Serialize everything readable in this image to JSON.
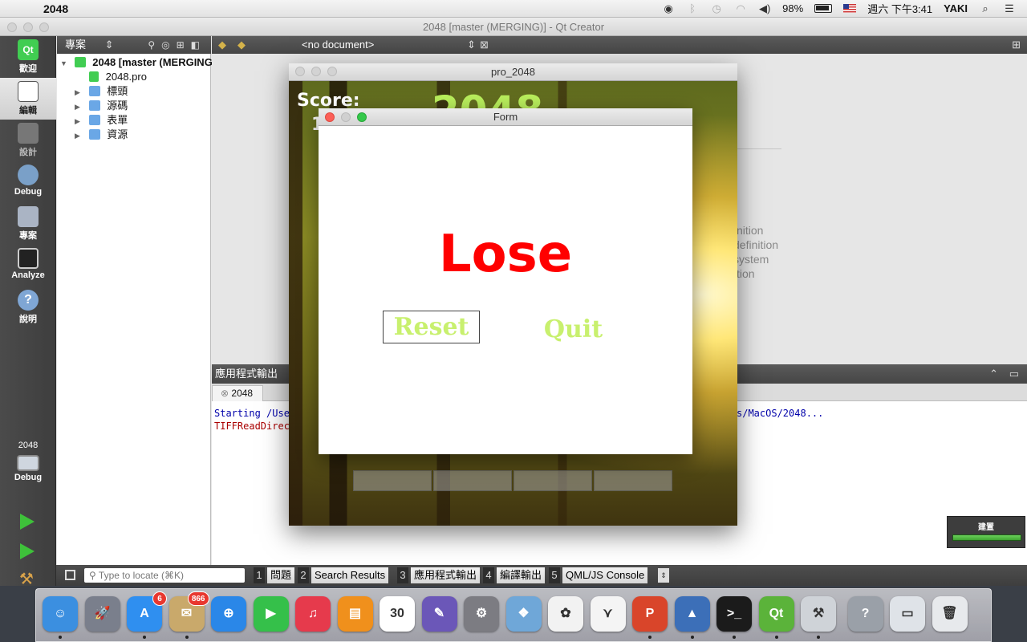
{
  "menubar": {
    "app_name": "2048",
    "battery": "98%",
    "datetime": "週六 下午3:41",
    "user": "YAKI"
  },
  "qt": {
    "window_title": "2048 [master (MERGING)] - Qt Creator",
    "modes": [
      {
        "label": "歡迎",
        "icon": "qt-welcome-icon"
      },
      {
        "label": "編輯",
        "icon": "edit-icon"
      },
      {
        "label": "設計",
        "icon": "design-icon"
      },
      {
        "label": "Debug",
        "icon": "debug-icon"
      },
      {
        "label": "專案",
        "icon": "projects-icon"
      },
      {
        "label": "Analyze",
        "icon": "analyze-icon"
      },
      {
        "label": "說明",
        "icon": "help-icon"
      }
    ],
    "kit": {
      "project": "2048",
      "build": "Debug"
    },
    "projects_pane": {
      "title": "專案",
      "root": "2048 [master (MERGING)]",
      "items": [
        "2048.pro",
        "標頭",
        "源碼",
        "表單",
        "資源"
      ]
    },
    "editor": {
      "document": "<no document>"
    },
    "welcome_fragments": [
      "nition",
      "definition",
      "system",
      "tion"
    ],
    "output": {
      "title": "應用程式輸出",
      "tab": "2048",
      "line1a": "Starting /Use",
      "line1b": "s/MacOS/2048...",
      "line2": "TIFFReadDirec"
    },
    "status": {
      "locate_placeholder": "Type to locate (⌘K)",
      "panes": [
        {
          "num": "1",
          "label": "問題"
        },
        {
          "num": "2",
          "label": "Search Results"
        },
        {
          "num": "3",
          "label": "應用程式輸出"
        },
        {
          "num": "4",
          "label": "編譯輸出"
        },
        {
          "num": "5",
          "label": "QML/JS Console"
        }
      ]
    },
    "build_status": {
      "label": "建置",
      "progress": 1.0
    }
  },
  "game": {
    "window_title": "pro_2048",
    "score_label": "Score:",
    "score_value": "1",
    "title": "2048"
  },
  "dialog": {
    "title": "Form",
    "message": "Lose",
    "reset_label": "Reset",
    "quit_label": "Quit"
  },
  "dock": {
    "apps": [
      {
        "name": "finder",
        "glyph": "☺",
        "color": "#3b8fe0",
        "running": true
      },
      {
        "name": "launchpad",
        "glyph": "🚀",
        "color": "#7a7f8c",
        "running": false
      },
      {
        "name": "app-store",
        "glyph": "A",
        "color": "#2f8ff0",
        "badge": "6",
        "running": true
      },
      {
        "name": "mail",
        "glyph": "✉",
        "color": "#c9a96b",
        "badge": "866",
        "running": true
      },
      {
        "name": "safari",
        "glyph": "⊕",
        "color": "#2a87e8",
        "running": false
      },
      {
        "name": "facetime",
        "glyph": "▶",
        "color": "#35c04a",
        "running": false
      },
      {
        "name": "itunes",
        "glyph": "♫",
        "color": "#e63a4c",
        "running": false
      },
      {
        "name": "ibooks",
        "glyph": "▤",
        "color": "#f0901c",
        "running": false
      },
      {
        "name": "calendar",
        "glyph": "30",
        "color": "#ffffff",
        "running": false
      },
      {
        "name": "script-editor",
        "glyph": "✎",
        "color": "#6b57b8",
        "running": false
      },
      {
        "name": "system-preferences",
        "glyph": "⚙",
        "color": "#7c7c82",
        "running": false
      },
      {
        "name": "preview",
        "glyph": "❖",
        "color": "#6fa7d8",
        "running": false
      },
      {
        "name": "photos",
        "glyph": "✿",
        "color": "#f2f2f2",
        "running": false
      },
      {
        "name": "acrobat",
        "glyph": "⋎",
        "color": "#f4f4f4",
        "running": false
      },
      {
        "name": "powerpoint",
        "glyph": "P",
        "color": "#d9452a",
        "running": true
      },
      {
        "name": "matlab",
        "glyph": "▲",
        "color": "#3c6fb8",
        "running": true
      },
      {
        "name": "terminal",
        "glyph": ">_",
        "color": "#1b1b1b",
        "running": true
      },
      {
        "name": "qt-creator",
        "glyph": "Qt",
        "color": "#5bb33a",
        "running": true
      },
      {
        "name": "xcode-instruments",
        "glyph": "⚒",
        "color": "#cfd3d8",
        "running": true
      },
      {
        "name": "help",
        "glyph": "?",
        "color": "#9aa0a8",
        "running": false
      },
      {
        "name": "downloads",
        "glyph": "▭",
        "color": "#dfe3e8",
        "running": false
      },
      {
        "name": "trash",
        "glyph": "🗑",
        "color": "#e7e9ec",
        "running": false
      }
    ]
  },
  "colors": {
    "lose_red": "#ff0000",
    "button_green": "#c8f06e",
    "title_green": "#b9ef5c",
    "qt_green": "#41cd52"
  }
}
